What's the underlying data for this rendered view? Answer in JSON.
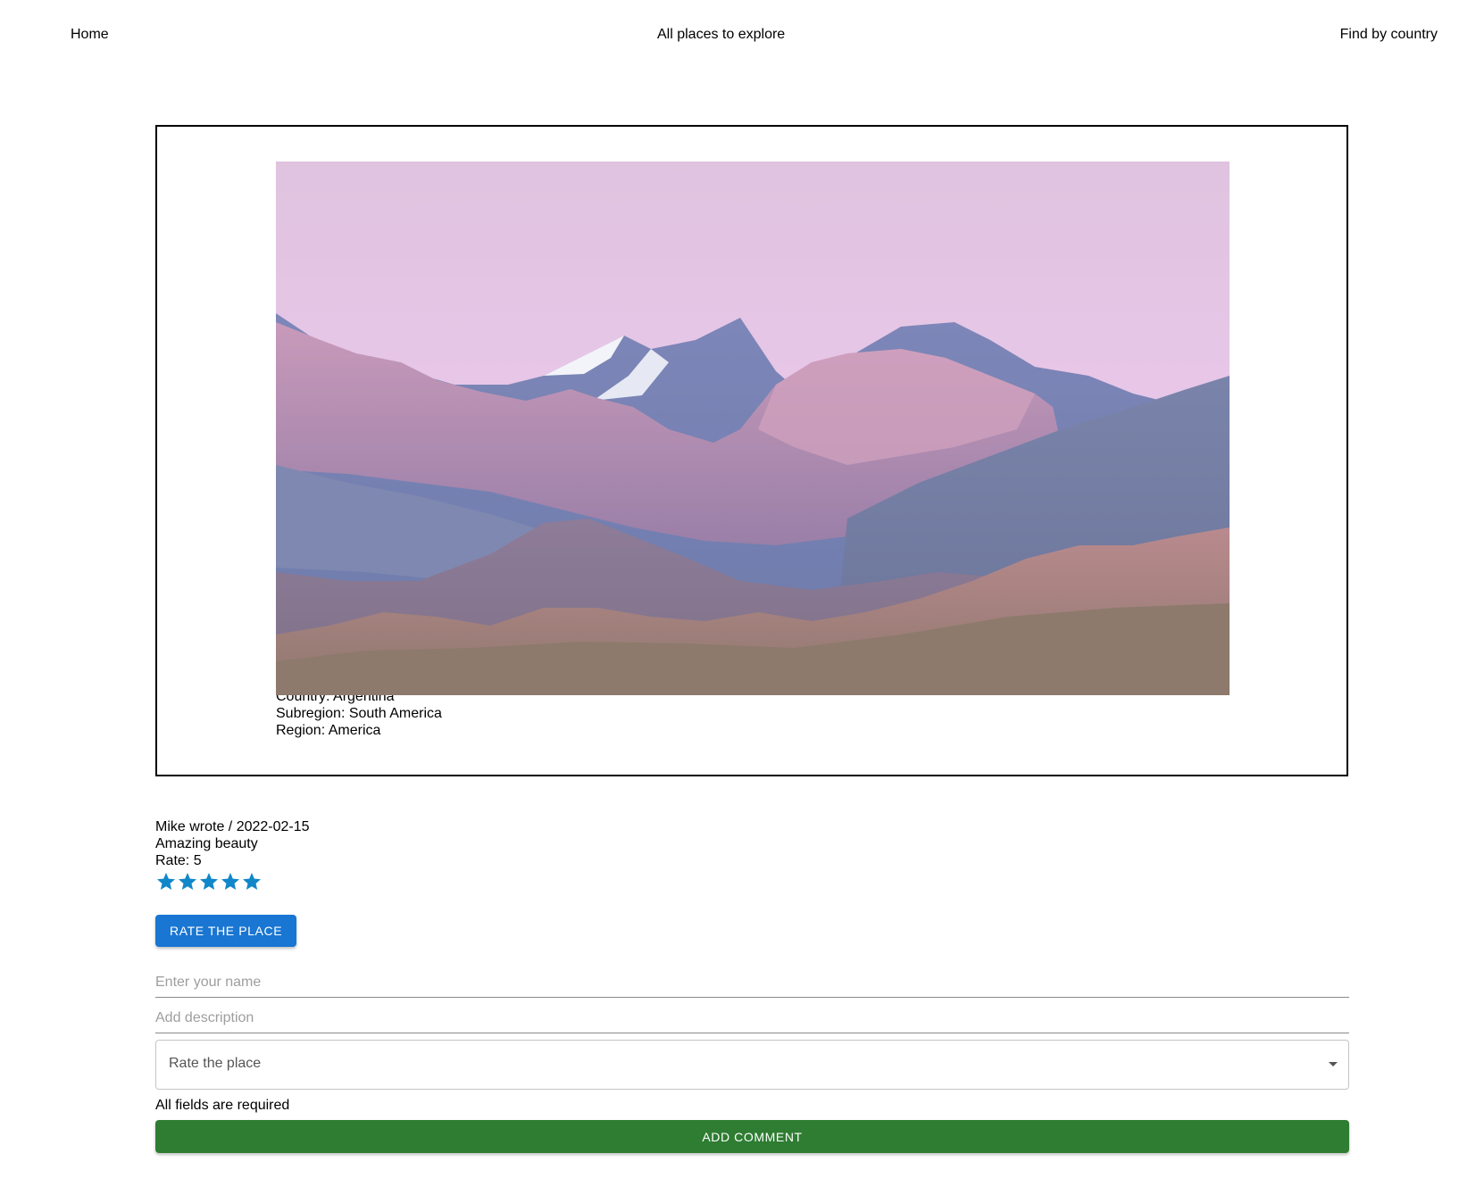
{
  "nav": {
    "home": "Home",
    "all_places": "All places to explore",
    "find_by_country": "Find by country"
  },
  "place": {
    "country": "Country: Argentina",
    "subregion": "Subregion: South America",
    "region": "Region: America"
  },
  "comments": [
    {
      "header": "Mike wrote / 2022-02-15",
      "text": "Amazing beauty",
      "rate_text": "Rate: 5",
      "stars": 5
    }
  ],
  "rate_button": "Rate the place",
  "form": {
    "name_placeholder": "Enter your name",
    "name_value": "",
    "description_placeholder": "Add description",
    "description_value": "",
    "rating_label": "Rate the place",
    "required_note": "All fields are required",
    "submit_label": "Add comment"
  },
  "colors": {
    "star": "#1187c9",
    "rate_button": "#1976d2",
    "add_button": "#2e7d32"
  }
}
